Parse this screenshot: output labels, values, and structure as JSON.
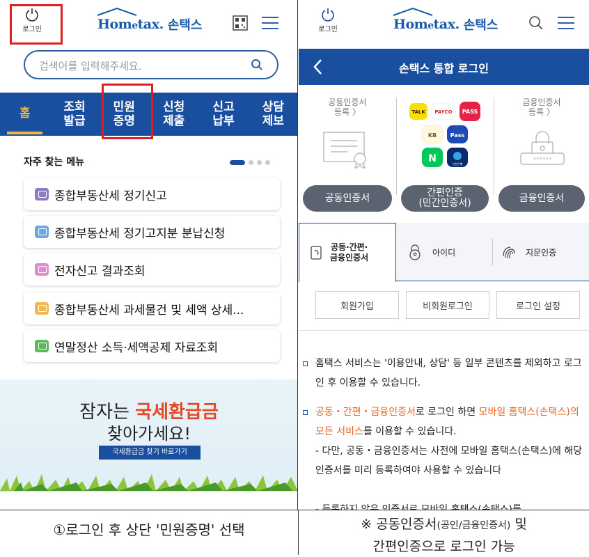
{
  "left": {
    "header": {
      "login_label": "로그인",
      "logo_brand": "Hom",
      "logo_e": "e",
      "logo_tax": "tax.",
      "logo_sontax": "손택스"
    },
    "search": {
      "placeholder": "검색어를 입력해주세요."
    },
    "nav": [
      {
        "line1": "홈",
        "line2": ""
      },
      {
        "line1": "조회",
        "line2": "발급"
      },
      {
        "line1": "민원",
        "line2": "증명"
      },
      {
        "line1": "신청",
        "line2": "제출"
      },
      {
        "line1": "신고",
        "line2": "납부"
      },
      {
        "line1": "상담",
        "line2": "제보"
      }
    ],
    "frequent_title": "자주 찾는 메뉴",
    "menu_items": [
      {
        "label": "종합부동산세 정기신고",
        "color": "#8e7cc3"
      },
      {
        "label": "종합부동산세 정기고지분 분납신청",
        "color": "#6fa8dc"
      },
      {
        "label": "전자신고 결과조회",
        "color": "#e58ad0"
      },
      {
        "label": "종합부동산세 과세물건 및 세액 상세...",
        "color": "#f1b84a"
      },
      {
        "label": "연말정산 소득·세액공제 자료조회",
        "color": "#5cb85c"
      }
    ],
    "banner": {
      "line1_a": "잠자는 ",
      "line1_b": "국세환급금",
      "line2": "찾아가세요!",
      "button": "국세환급금 찾기 바로가기"
    },
    "caption": "①로그인 후 상단 '민원증명' 선택"
  },
  "right": {
    "header": {
      "login_label": "로그인"
    },
    "title": "손택스 통합 로그인",
    "certs": [
      {
        "caption_l1": "공동인증서",
        "caption_l2": "등록 〉",
        "button_l1": "공동인증서",
        "button_l2": ""
      },
      {
        "caption_l1": "",
        "caption_l2": "",
        "button_l1": "간편인증",
        "button_l2": "(민간인증서)"
      },
      {
        "caption_l1": "금융인증서",
        "caption_l2": "등록 〉",
        "button_l1": "금융인증서",
        "button_l2": ""
      }
    ],
    "apps": {
      "talk": "TALK",
      "payco": "PAYCO",
      "pass": "PASS",
      "kb": "KB",
      "samsung_pass": "Pass",
      "naver": "N",
      "shinhan": "신한은행"
    },
    "tabs": [
      {
        "l1": "공동·간편·",
        "l2": "금융인증서"
      },
      {
        "l1": "아이디",
        "l2": ""
      },
      {
        "l1": "지문인증",
        "l2": ""
      }
    ],
    "sub_buttons": [
      "회원가입",
      "비회원로그인",
      "로그인 설정"
    ],
    "notice1": "홈택스 서비스는 '이용안내, 상담' 등 일부 콘텐츠를 제외하고 로그인 후 이용할 수 있습니다.",
    "notice2_a": "공동・간편・금융인증서",
    "notice2_b": "로 로그인 하면 ",
    "notice2_c": "모바일 홈택스(손택스)의 모든 서비스",
    "notice2_d": "를 이용할 수 있습니다.",
    "notice3": "- 다만, 공동・금융인증서는 사전에 모바일 홈택스(손택스)에 해당 인증서를 미리 등록하여야 사용할 수 있습니다",
    "notice4": "- 등록하지 않은 인증서로 모바일 홈택스(손택스)를",
    "caption_l1_a": "※ 공동인증서",
    "caption_l1_b": "(공인/금융인증서)",
    "caption_l1_c": " 및",
    "caption_l2": "간편인증으로 로그인 가능"
  },
  "colors": {
    "primary": "#1a4fa0",
    "accent_orange": "#e8631c",
    "home_tab": "#f5b63a",
    "highlight": "#e02020"
  }
}
